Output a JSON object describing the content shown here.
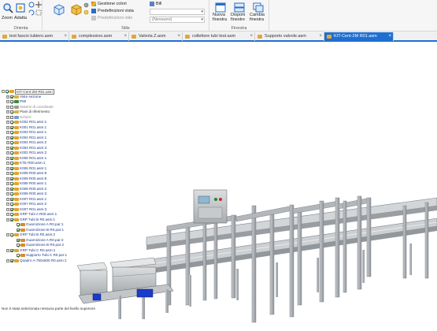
{
  "ribbon": {
    "orienta_group": {
      "label": "Orienta",
      "buttons": [
        {
          "label": "Zoom",
          "icon": "zoom-icon"
        },
        {
          "label": "Adatta",
          "icon": "fit-icon"
        }
      ]
    },
    "stile_group": {
      "label": "Stile",
      "rows": [
        "Gestione colori",
        "Predefinizioni vista",
        "Predefinizioni stile"
      ],
      "combo_value": "",
      "combo_placeholder": "(Nessuno)",
      "extra_label": "Bill"
    },
    "finestra_group": {
      "label": "Finestra",
      "buttons": [
        {
          "label": "Nuova finestra",
          "icon": "new-window-icon"
        },
        {
          "label": "Disponi finestre",
          "icon": "arrange-windows-icon"
        },
        {
          "label": "Cambia finestra",
          "icon": "switch-window-icon"
        }
      ]
    }
  },
  "tabs": [
    {
      "label": "test fascio tubiero.asm",
      "active": false
    },
    {
      "label": "complessivo.asm",
      "active": false
    },
    {
      "label": "Valvola Z.asm",
      "active": false
    },
    {
      "label": "collettore tubi test.asm",
      "active": false
    },
    {
      "label": "Supporto valvole.asm",
      "active": false
    },
    {
      "label": "KIT-Cent-2M R01.asm",
      "active": true
    }
  ],
  "tree": {
    "nodes": [
      {
        "label": "KIT-Cent-2M R01.asm",
        "type": "root",
        "checked": true,
        "expander": "-",
        "icon": "assembly-icon"
      },
      {
        "label": "Viste sezione",
        "type": "folder",
        "checked": true,
        "expander": "+",
        "icon": "folder-icon"
      },
      {
        "label": "PMI",
        "type": "folder",
        "checked": true,
        "expander": "+",
        "icon": "pmi-icon"
      },
      {
        "label": "Sistemi di coordinate",
        "type": "grey",
        "checked": false,
        "expander": "+",
        "icon": "coordinate-icon"
      },
      {
        "label": "Piani di riferimento",
        "type": "plain",
        "checked": true,
        "expander": "+",
        "icon": "plane-icon"
      },
      {
        "label": "Schizzi",
        "type": "grey",
        "checked": false,
        "expander": "+",
        "icon": "sketch-icon"
      },
      {
        "label": "K002 R01.asm:1",
        "type": "asm",
        "checked": true,
        "expander": "+",
        "icon": "subassembly-icon"
      },
      {
        "label": "K001 R01.asm:1",
        "type": "asm",
        "checked": true,
        "expander": "+",
        "icon": "subassembly-icon"
      },
      {
        "label": "K003 R01.asm:1",
        "type": "asm",
        "checked": true,
        "expander": "+",
        "icon": "subassembly-icon"
      },
      {
        "label": "K004 R01.asm:1",
        "type": "asm",
        "checked": true,
        "expander": "+",
        "icon": "subassembly-icon"
      },
      {
        "label": "K004 R01.asm:2",
        "type": "asm",
        "checked": true,
        "expander": "+",
        "icon": "subassembly-icon"
      },
      {
        "label": "K004 R01.asm:3",
        "type": "asm",
        "checked": true,
        "expander": "+",
        "icon": "subassembly-icon"
      },
      {
        "label": "K002 R01.asm:2",
        "type": "asm",
        "checked": true,
        "expander": "+",
        "icon": "subassembly-icon"
      },
      {
        "label": "K005 R01.asm:1",
        "type": "asm",
        "checked": true,
        "expander": "+",
        "icon": "subassembly-icon"
      },
      {
        "label": "KTE R00.asm:1",
        "type": "asm",
        "checked": true,
        "expander": "+",
        "icon": "subassembly-icon"
      },
      {
        "label": "K006 R01.asm:1",
        "type": "asm",
        "checked": true,
        "expander": "+",
        "icon": "subassembly-icon"
      },
      {
        "label": "K009 R00.asm:8",
        "type": "asm",
        "checked": true,
        "expander": "+",
        "icon": "subassembly-icon"
      },
      {
        "label": "K009 R00.asm:9",
        "type": "asm",
        "checked": true,
        "expander": "+",
        "icon": "subassembly-icon"
      },
      {
        "label": "K008 R00.asm:1",
        "type": "asm",
        "checked": true,
        "expander": "+",
        "icon": "subassembly-icon"
      },
      {
        "label": "K008 R00.asm:2",
        "type": "asm",
        "checked": true,
        "expander": "+",
        "icon": "subassembly-icon"
      },
      {
        "label": "K008 R00.asm:3",
        "type": "asm",
        "checked": true,
        "expander": "+",
        "icon": "subassembly-icon"
      },
      {
        "label": "K007 R01.asm:1",
        "type": "asm",
        "checked": true,
        "expander": "+",
        "icon": "subassembly-icon"
      },
      {
        "label": "K007 R01.asm:2",
        "type": "asm",
        "checked": true,
        "expander": "+",
        "icon": "subassembly-icon"
      },
      {
        "label": "K007 R01.asm:3",
        "type": "asm",
        "checked": true,
        "expander": "+",
        "icon": "subassembly-icon"
      },
      {
        "label": "GRP Tubi A R00.asm:1",
        "type": "asm",
        "checked": true,
        "expander": "+",
        "icon": "subassembly-icon"
      },
      {
        "label": "GRP Tubi B R0.asm:1",
        "type": "asm",
        "checked": true,
        "expander": "+",
        "icon": "subassembly-icon"
      },
      {
        "label": "Guarnizione A R0.par:1",
        "type": "par",
        "checked": true,
        "expander": "",
        "icon": "part-icon"
      },
      {
        "label": "Guarnizione B R0.par:1",
        "type": "par",
        "checked": true,
        "expander": "",
        "icon": "part-icon"
      },
      {
        "label": "GRP Tubi B R0.asm:2",
        "type": "asm",
        "checked": true,
        "expander": "+",
        "icon": "subassembly-icon"
      },
      {
        "label": "Guarnizione A R0.par:2",
        "type": "par",
        "checked": true,
        "expander": "",
        "icon": "part-icon"
      },
      {
        "label": "Guarnizione B R0.par:2",
        "type": "par",
        "checked": true,
        "expander": "",
        "icon": "part-icon"
      },
      {
        "label": "GRP Tubi C R0.asm:1",
        "type": "asm",
        "checked": true,
        "expander": "+",
        "icon": "subassembly-icon"
      },
      {
        "label": "Supporto Tubi C R0.par:1",
        "type": "par",
        "checked": true,
        "expander": "",
        "icon": "part-icon"
      },
      {
        "label": "Quadro A-750x600 R0.asm:1",
        "type": "asm",
        "checked": true,
        "expander": "+",
        "icon": "subassembly-icon"
      }
    ]
  },
  "status": {
    "text": "Non è stata selezionata nessuna parte del livello superiore"
  },
  "colors": {
    "accent": "#1f6fd1",
    "frame": "#b9bcbf",
    "frame_dark": "#7f8488",
    "conveyor_blue": "#1a3cc8"
  }
}
